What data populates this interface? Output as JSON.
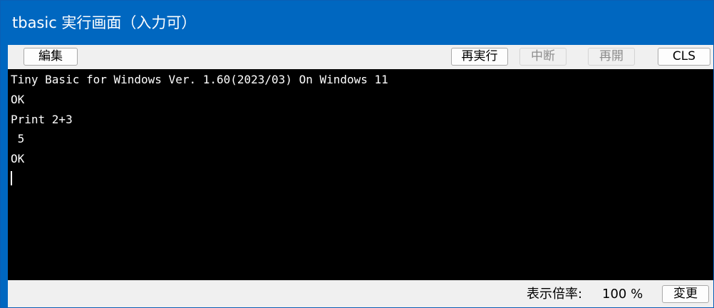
{
  "window": {
    "title": "tbasic 実行画面（入力可）"
  },
  "toolbar": {
    "edit_label": "編集",
    "rerun_label": "再実行",
    "pause_label": "中断",
    "resume_label": "再開",
    "cls_label": "CLS"
  },
  "console": {
    "lines": [
      "Tiny Basic for Windows Ver. 1.60(2023/03) On Windows 11",
      "OK",
      "Print 2+3",
      " 5",
      "OK"
    ]
  },
  "status": {
    "zoom_label": "表示倍率:",
    "zoom_value": "100 %",
    "change_label": "変更"
  },
  "colors": {
    "titlebar": "#0067c0",
    "console_bg": "#000000",
    "console_fg": "#ffffff",
    "toolbar_bg": "#f0f0f0"
  }
}
